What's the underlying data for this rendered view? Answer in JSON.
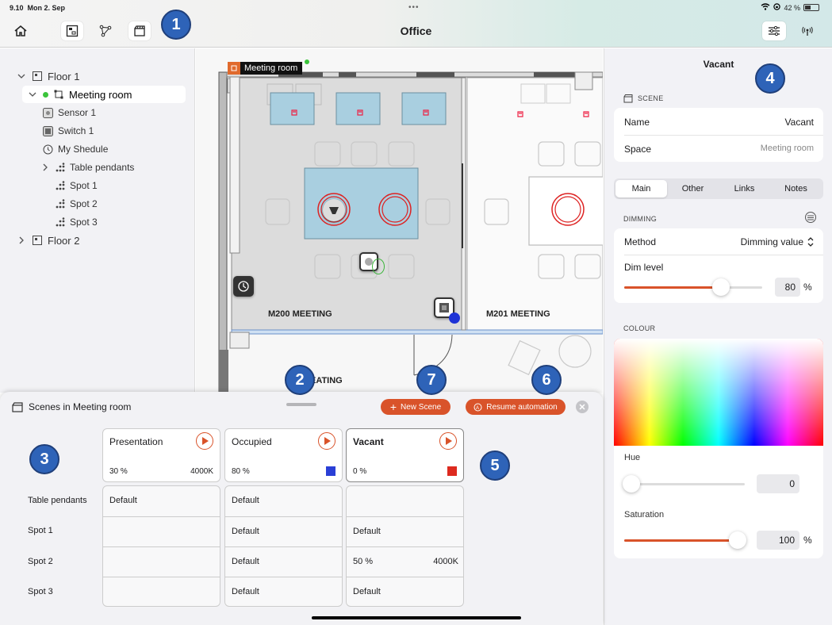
{
  "status_bar": {
    "time": "9.10",
    "date": "Mon 2. Sep",
    "battery": "42 %",
    "battery_level": 0.42
  },
  "nav": {
    "title": "Office"
  },
  "badges": [
    "1",
    "2",
    "3",
    "4",
    "5",
    "6",
    "7"
  ],
  "tree": {
    "items": [
      {
        "label": "Floor 1"
      },
      {
        "label": "Meeting room"
      },
      {
        "label": "Sensor 1"
      },
      {
        "label": "Switch 1"
      },
      {
        "label": "My Shedule"
      },
      {
        "label": "Table pendants"
      },
      {
        "label": "Spot 1"
      },
      {
        "label": "Spot 2"
      },
      {
        "label": "Spot 3"
      },
      {
        "label": "Floor 2"
      }
    ]
  },
  "plan": {
    "room_tag": "Meeting room",
    "room_labels": [
      "M200 MEETING",
      "M201 MEETING",
      "EATING"
    ]
  },
  "panel": {
    "title": "Vacant",
    "scene_section": "SCENE",
    "name_label": "Name",
    "name_value": "Vacant",
    "space_label": "Space",
    "space_value": "Meeting room",
    "tabs": [
      "Main",
      "Other",
      "Links",
      "Notes"
    ],
    "dimming_section": "DIMMING",
    "method_label": "Method",
    "method_value": "Dimming value",
    "dim_label": "Dim level",
    "dim_value": "80",
    "dim_unit": "%",
    "dim_fraction": 0.8,
    "colour_section": "COLOUR",
    "hue_label": "Hue",
    "hue_value": "0",
    "hue_fraction": 0.0,
    "sat_label": "Saturation",
    "sat_value": "100",
    "sat_unit": "%",
    "sat_fraction": 1.0
  },
  "sheet": {
    "title": "Scenes in Meeting room",
    "new_scene": "New Scene",
    "resume": "Resume automation",
    "scenes": [
      {
        "name": "Presentation",
        "left": "30 %",
        "right": "4000K",
        "color": ""
      },
      {
        "name": "Occupied",
        "left": "80 %",
        "right": "",
        "color": "#2a3fd6"
      },
      {
        "name": "Vacant",
        "left": "0 %",
        "right": "",
        "color": "#dd2a1f"
      }
    ],
    "row_labels": [
      "Table pendants",
      "Spot 1",
      "Spot 2",
      "Spot 3"
    ],
    "cells": [
      [
        {
          "l": "Default",
          "r": ""
        },
        {
          "l": "",
          "r": ""
        },
        {
          "l": "",
          "r": ""
        },
        {
          "l": "",
          "r": ""
        }
      ],
      [
        {
          "l": "Default",
          "r": ""
        },
        {
          "l": "Default",
          "r": ""
        },
        {
          "l": "Default",
          "r": ""
        },
        {
          "l": "Default",
          "r": ""
        }
      ],
      [
        {
          "l": "",
          "r": ""
        },
        {
          "l": "Default",
          "r": ""
        },
        {
          "l": "50 %",
          "r": "4000K"
        },
        {
          "l": "Default",
          "r": ""
        }
      ]
    ]
  },
  "colors": {
    "accent": "#d9532a",
    "badge": "#2e63b8"
  }
}
